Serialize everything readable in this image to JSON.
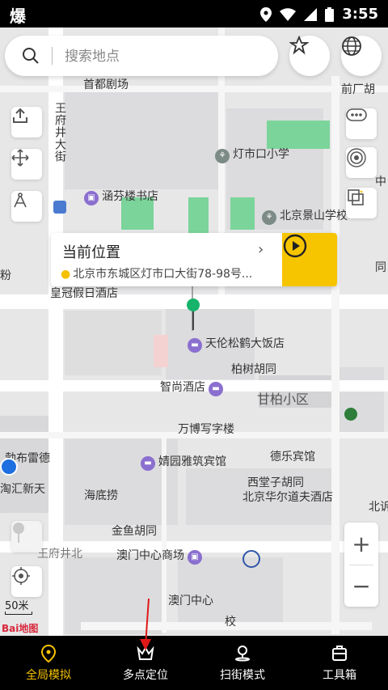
{
  "status_bar": {
    "app_glyph": "爆",
    "time": "3:55"
  },
  "search": {
    "placeholder": "搜索地点"
  },
  "location_card": {
    "title": "当前位置",
    "address": "北京市东城区灯市口大街78-98号..."
  },
  "map_labels": {
    "capital_theater": "首都剧场",
    "qianchang": "前厂胡",
    "wangfujing": "王府井大街",
    "dengshikou_school": "灯市口小学",
    "hanfenlou": "涵芬楼书店",
    "beijing_school": "北京景山学校",
    "crown_hotel": "皇冠假日酒店",
    "tianlun": "天伦松鹤大饭店",
    "baishu": "柏树胡同",
    "zhishang": "智尚酒店",
    "ganbai": "甘柏小区",
    "wanbo": "万博写字楼",
    "buleide": "勃布雷德",
    "deyue": "德乐宾馆",
    "jingyi": "婧园雅筑宾馆",
    "xitang": "西堂子胡同",
    "haihui": "淘汇新天",
    "haidilao": "海底捞",
    "huaer": "北京华尔道夫酒店",
    "jinyu": "金鱼胡同",
    "wangfujing_north": "王府井北",
    "macau_mall": "澳门中心商场",
    "macau_center": "澳门中心",
    "fen": "粉",
    "tong": "同",
    "beishi": "北诉",
    "wang": "王",
    "xiao": "校",
    "zhong": "中",
    "bei_short": "北"
  },
  "scale": {
    "text": "50米"
  },
  "brand": {
    "text": "Bai地图"
  },
  "bottom_nav": {
    "global": "全局模拟",
    "multi": "多点定位",
    "scan": "扫街模式",
    "toolbox": "工具箱"
  },
  "colors": {
    "accent": "#f7c400",
    "green": "#6fd28b",
    "poi": "#8b6fcf"
  },
  "icons": [
    "search-icon",
    "star-icon",
    "globe-icon",
    "upload-icon",
    "move-icon",
    "compass-icon",
    "dots-icon",
    "satellite-icon",
    "layers-icon",
    "location-pin-icon",
    "target-icon",
    "play-icon",
    "plus-icon",
    "minus-icon",
    "toolbox-icon",
    "crown-icon",
    "scan-pin-icon"
  ]
}
